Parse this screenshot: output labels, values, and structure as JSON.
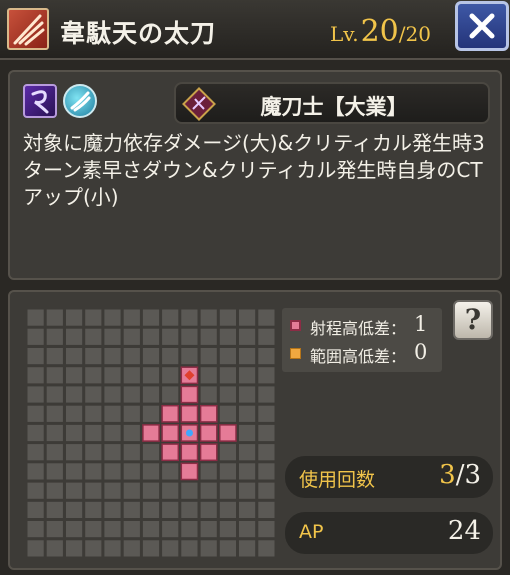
{
  "header": {
    "title": "韋駄天の太刀",
    "level_label": "Lv.",
    "level_value": "20",
    "level_max": "/20",
    "skill_icon": "slash-skill-icon",
    "close_icon": "close-x-icon"
  },
  "skill": {
    "attributes": [
      {
        "icon": "dark-element-icon"
      },
      {
        "icon": "wind-element-icon"
      }
    ],
    "job": {
      "name": "魔刀士【大業】",
      "icon": "job-emblem-icon"
    },
    "description": "対象に魔力依存ダメージ(大)&クリティカル発生時3ターン素早さダウン&クリティカル発生時自身のCTアップ(小)"
  },
  "range": {
    "legend": [
      {
        "label": "射程高低差：",
        "value": "1"
      },
      {
        "label": "範囲高低差：",
        "value": "0"
      }
    ],
    "help_label": "?"
  },
  "stats": {
    "uses_label": "使用回数",
    "uses_current": "3",
    "uses_max": "/3",
    "ap_label": "AP",
    "ap_value": "24"
  },
  "colors": {
    "accent_gold": "#f1c44a",
    "range_tile": "#e57b97",
    "area_tile": "#f0a840",
    "grid_tile": "#5b5955"
  }
}
